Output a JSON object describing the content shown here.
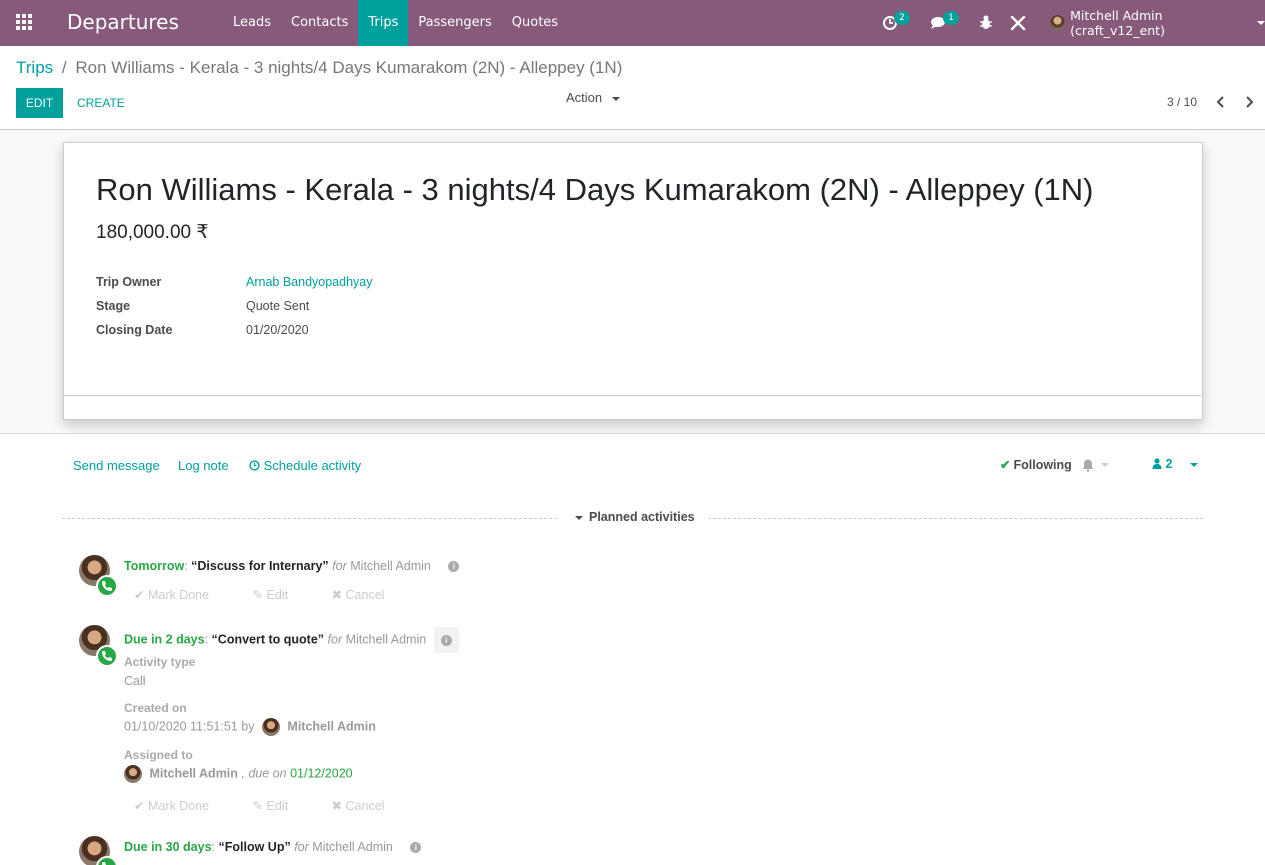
{
  "navbar": {
    "brand": "Departures",
    "menu": [
      "Leads",
      "Contacts",
      "Trips",
      "Passengers",
      "Quotes"
    ],
    "activity_count": "2",
    "message_count": "1",
    "user": "Mitchell Admin (craft_v12_ent)",
    "icons": [
      "apps-grid-icon",
      "activity-clock-icon",
      "chat-icon",
      "bug-icon",
      "tools-icon"
    ],
    "bg_color": "#875a7b",
    "accent_color": "#00a09d"
  },
  "control_panel": {
    "breadcrumb_root": "Trips",
    "breadcrumb_sep": "/",
    "breadcrumb_current": "Ron Williams - Kerala - 3 nights/4 Days Kumarakom (2N) - Alleppey (1N)",
    "edit_label": "EDIT",
    "create_label": "CREATE",
    "action_label": "Action",
    "pager": "3 / 10"
  },
  "record": {
    "title": "Ron Williams - Kerala - 3 nights/4 Days Kumarakom (2N) - Alleppey (1N)",
    "amount": "180,000.00 ₹",
    "fields": [
      {
        "label": "Trip Owner",
        "value": "Arnab Bandyopadhyay"
      },
      {
        "label": "Stage",
        "value": "Quote Sent"
      },
      {
        "label": "Closing Date",
        "value": "01/20/2020"
      }
    ]
  },
  "chatter": {
    "send_message": "Send message",
    "log_note": "Log note",
    "schedule_activity": "Schedule activity",
    "following": "Following",
    "followers": "2",
    "planned_activities": "Planned activities",
    "activities": [
      {
        "due": "Tomorrow",
        "summary": "“Discuss for Internary”",
        "for": "for",
        "user": "Mitchell Admin"
      },
      {
        "due": "Due in 2 days",
        "summary": "“Convert to quote”",
        "for": "for",
        "user": "Mitchell Admin",
        "details": {
          "type_label": "Activity type",
          "type_value": "Call",
          "created_label": "Created on",
          "created_value": "01/10/2020 11:51:51",
          "by": "by",
          "created_by": "Mitchell Admin",
          "assigned_label": "Assigned to",
          "assigned_user": "Mitchell Admin",
          "due_on": ", due on",
          "due_date": "01/12/2020"
        }
      },
      {
        "due": "Due in 30 days",
        "summary": "“Follow Up”",
        "for": "for",
        "user": "Mitchell Admin"
      }
    ],
    "mark_done": "Mark Done",
    "edit": "Edit",
    "cancel": "Cancel"
  }
}
